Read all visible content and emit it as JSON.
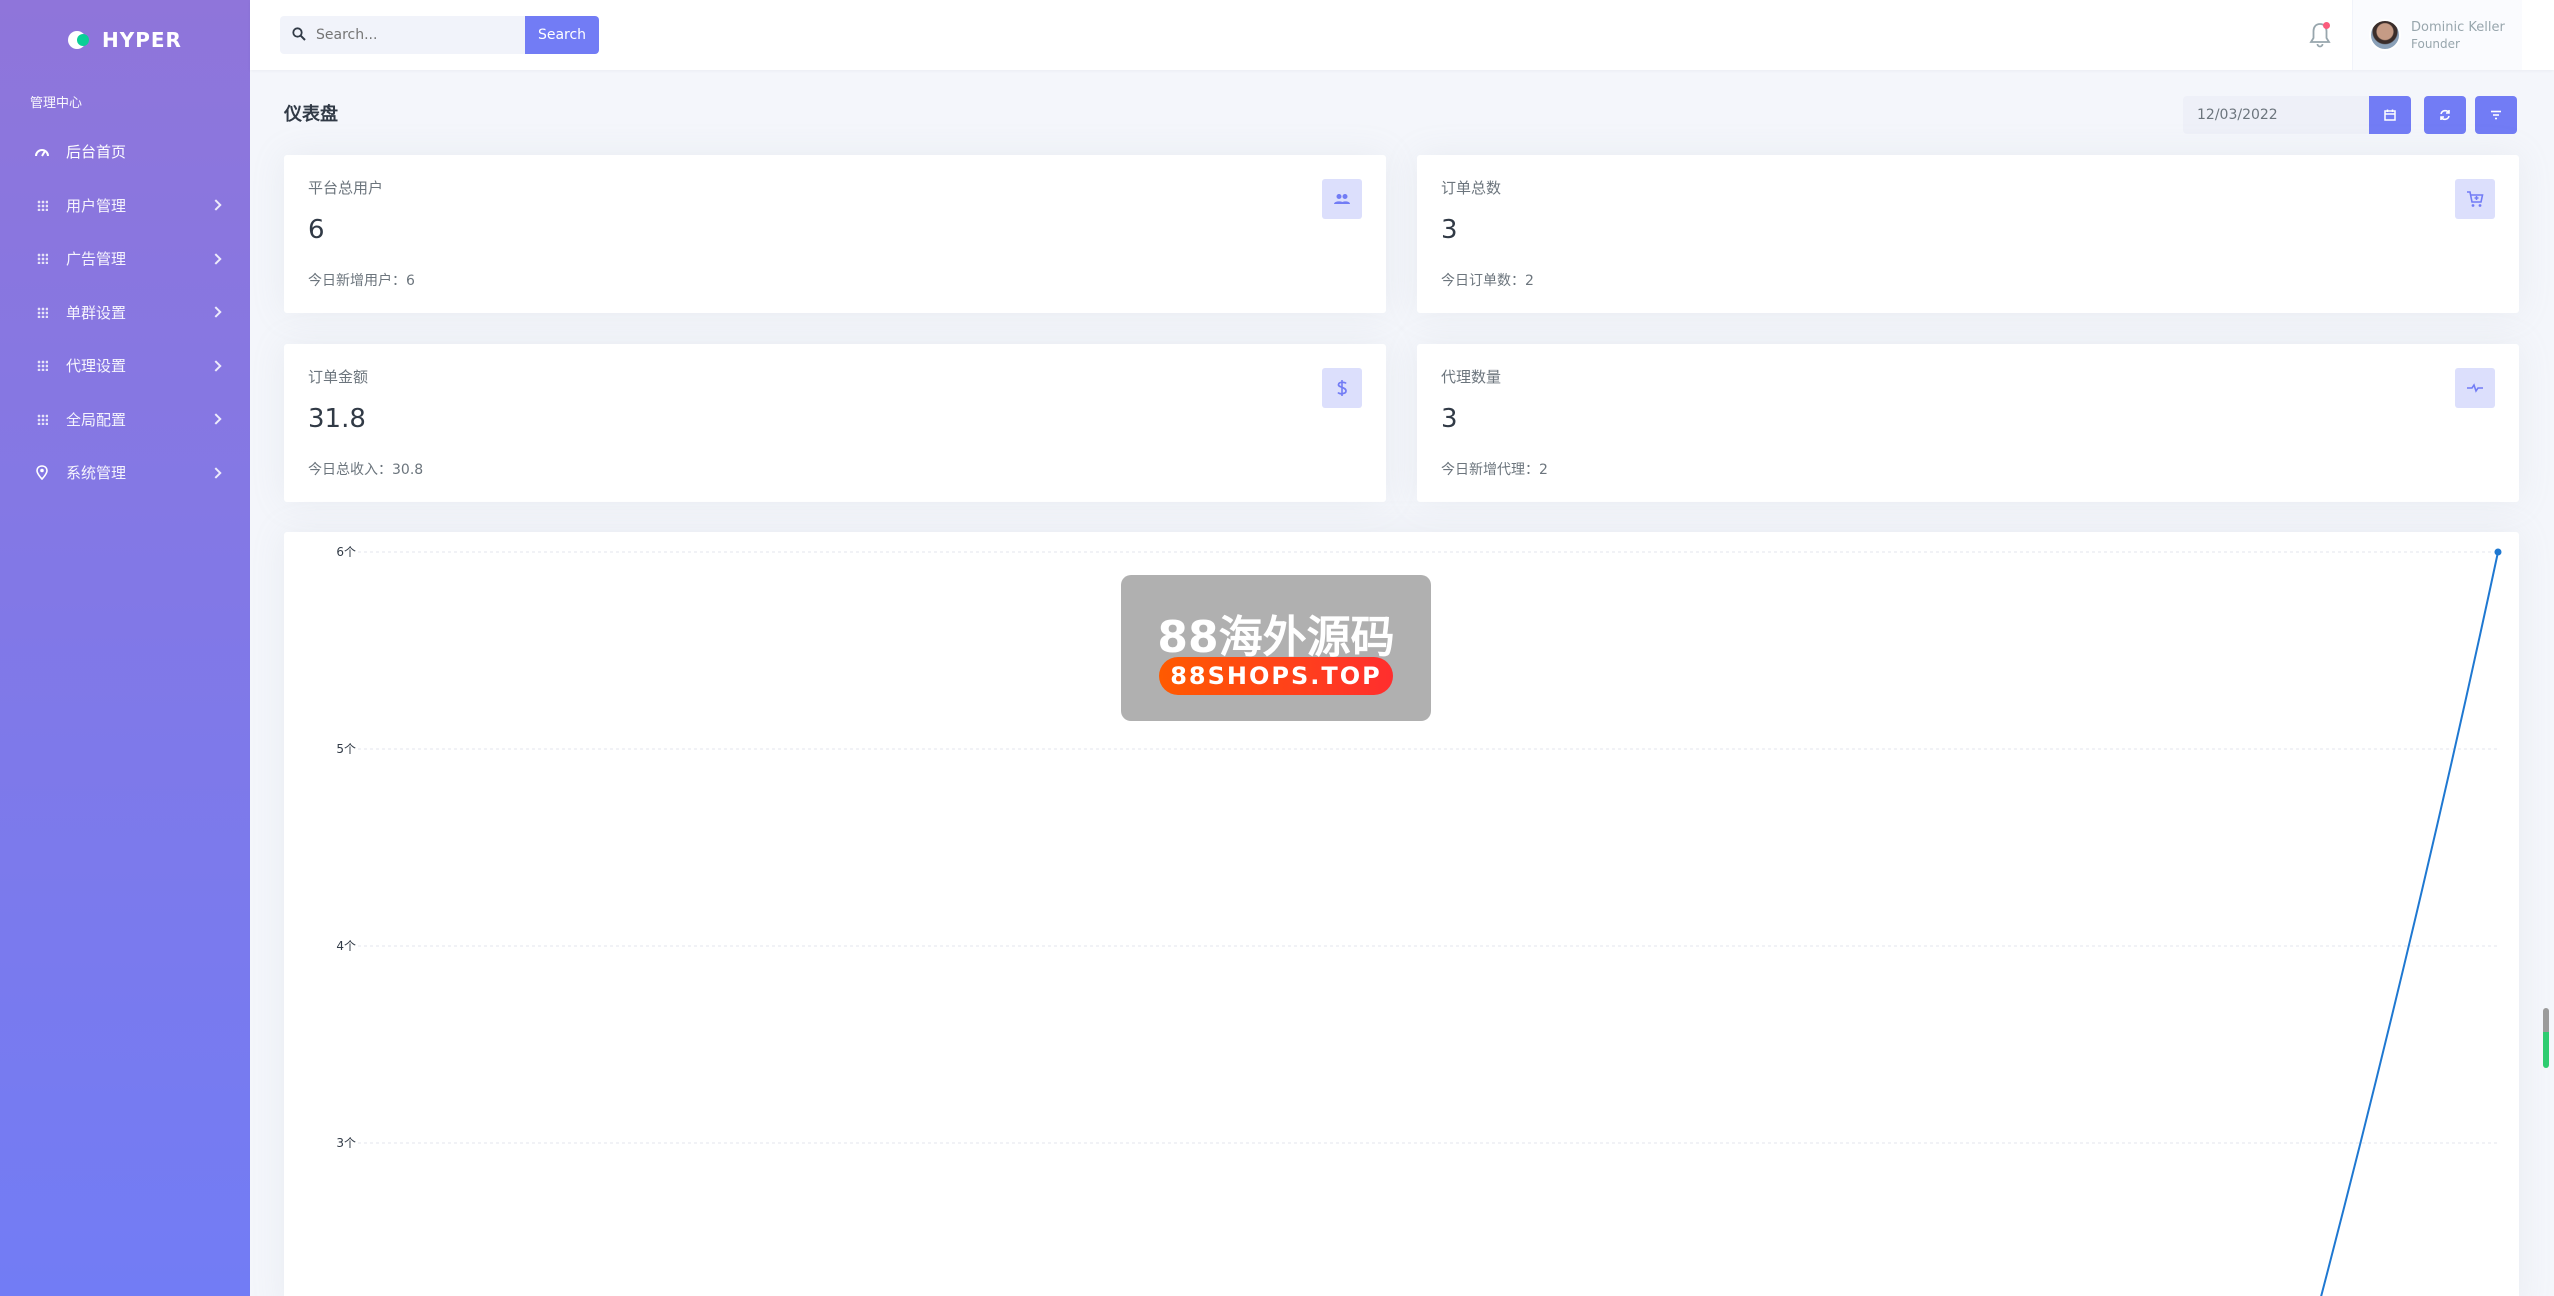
{
  "brand": {
    "name": "HYPER"
  },
  "sidebar": {
    "section_title": "管理中心",
    "items": [
      {
        "label": "后台首页",
        "icon": "dashboard-icon",
        "active": true
      },
      {
        "label": "用户管理",
        "icon": "grid-icon"
      },
      {
        "label": "广告管理",
        "icon": "grid-icon"
      },
      {
        "label": "单群设置",
        "icon": "grid-icon"
      },
      {
        "label": "代理设置",
        "icon": "grid-icon"
      },
      {
        "label": "全局配置",
        "icon": "grid-icon"
      },
      {
        "label": "系统管理",
        "icon": "location-icon"
      }
    ]
  },
  "topbar": {
    "search_placeholder": "Search...",
    "search_button": "Search",
    "user": {
      "name": "Dominic Keller",
      "role": "Founder"
    }
  },
  "page": {
    "title": "仪表盘",
    "date": "12/03/2022"
  },
  "stats": [
    {
      "title": "平台总用户",
      "value": "6",
      "sub": "今日新增用户：6",
      "icon": "users-icon"
    },
    {
      "title": "订单总数",
      "value": "3",
      "sub": "今日订单数：2",
      "icon": "cart-icon"
    },
    {
      "title": "订单金额",
      "value": "31.8",
      "sub": "今日总收入：30.8",
      "icon": "dollar-icon"
    },
    {
      "title": "代理数量",
      "value": "3",
      "sub": "今日新增代理：2",
      "icon": "pulse-icon"
    }
  ],
  "watermark": {
    "line1": "88海外源码",
    "line2": "88SHOPS.TOP"
  },
  "chart_data": {
    "type": "line",
    "y_ticks": [
      "6个",
      "5个",
      "4个",
      "3个"
    ],
    "ylim_visible": [
      2.2,
      6
    ],
    "series": [
      {
        "values": [
          2.2,
          6
        ]
      }
    ],
    "grid": true,
    "line_color": "#1f78d1"
  },
  "colors": {
    "primary": "#727cf5",
    "sidebar_top": "#8f75da",
    "alert": "#fa5c7c"
  }
}
